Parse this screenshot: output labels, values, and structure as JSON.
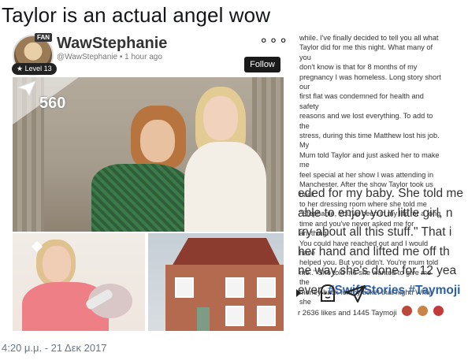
{
  "tweet": {
    "text": "Taylor is an actual angel wow",
    "timestamp": "4:20 μ.μ. - 21 Δεκ 2017"
  },
  "post": {
    "username": "WawStephanie",
    "handle_line": "@WawStephanie • 1 hour ago",
    "fan_tag": "FAN",
    "level": "Level 13",
    "follow_label": "Follow",
    "views": "560",
    "more_icon": "more-dots-icon"
  },
  "story": {
    "small_lines": [
      "while. I've finally decided to tell you all what",
      "Taylor did for me this night. What many of you",
      "don't know is that for 8 months of my",
      "pregnancy I was homeless. Long story short our",
      "first flat was condemned for health and safety",
      "reasons and we lost everything. To add to the",
      "stress, during this time Matthew lost his job. My",
      "Mum told Taylor and just asked her to make me",
      "feel special at her show I was attending in",
      "Manchester. After the show Taylor took us back",
      "to her dressing room where she told me",
      "\"Stephanie, You've been in my life for a long",
      "time and you've never asked me for anything.",
      "You could have reached out and I would have",
      "helped you. But you didn't. You're mum told",
      "me..\" She told me she wanted to give me the",
      "money back for my ticket that night. What she"
    ],
    "big_lines": [
      "eded for my baby. She told me",
      "able to enjoy your little girl, n",
      "rry about all this stuff.\" That i",
      " her hand and lifted me off th",
      "ne way she's done for 12 yea",
      "ever. "
    ],
    "hashtags": "#SwiftStories #Taymoji",
    "likes_line": "r 2636 likes and 1445 Taymoji"
  },
  "colors": {
    "hashtag": "#2b5fa8",
    "timestamp": "#657786",
    "follow_bg": "#1a1a1a"
  }
}
